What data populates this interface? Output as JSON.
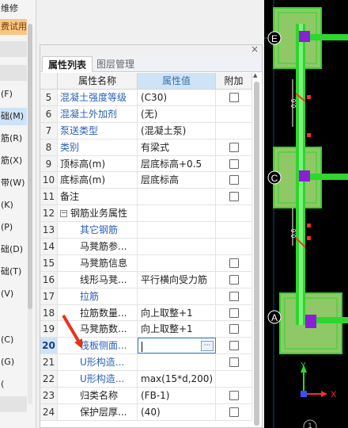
{
  "left_menu": {
    "items": [
      {
        "label": "维修"
      },
      {
        "label": "费试用"
      },
      {
        "label": "(F)"
      },
      {
        "label": "础(M)"
      },
      {
        "label": "筋(R)"
      },
      {
        "label": "筋(X)"
      },
      {
        "label": "带(W)"
      },
      {
        "label": "(K)"
      },
      {
        "label": "(P)"
      },
      {
        "label": "础(D)"
      },
      {
        "label": "础(T)"
      },
      {
        "label": "(V)"
      },
      {
        "label": ""
      },
      {
        "label": "(C)"
      },
      {
        "label": "(G)"
      },
      {
        "label": "("
      }
    ]
  },
  "panel": {
    "close_glyph": "×",
    "tabs": [
      "属性列表",
      "图层管理"
    ],
    "columns": {
      "name": "属性名称",
      "value": "属性值",
      "add": "附加"
    },
    "rows": [
      {
        "num": "5",
        "name": "混凝土强度等级",
        "value": "(C30)",
        "blue": true,
        "check": true
      },
      {
        "num": "6",
        "name": "混凝土外加剂",
        "value": "(无)",
        "blue": true,
        "check": false
      },
      {
        "num": "7",
        "name": "泵送类型",
        "value": "(混凝土泵)",
        "blue": true,
        "check": false
      },
      {
        "num": "8",
        "name": "类别",
        "value": "有梁式",
        "blue": true,
        "check": true
      },
      {
        "num": "9",
        "name": "顶标高(m)",
        "value": "层底标高+0.5",
        "blue": false,
        "check": true
      },
      {
        "num": "10",
        "name": "底标高(m)",
        "value": "层底标高",
        "blue": false,
        "check": true
      },
      {
        "num": "11",
        "name": "备注",
        "value": "",
        "blue": false,
        "check": true
      },
      {
        "num": "12",
        "name": "钢筋业务属性",
        "value": "",
        "blue": false,
        "check": false,
        "group": true,
        "toggle": "−"
      },
      {
        "num": "13",
        "name": "其它钢筋",
        "value": "",
        "blue": true,
        "check": false,
        "indent": true
      },
      {
        "num": "14",
        "name": "马凳筋参...",
        "value": "",
        "blue": false,
        "check": false,
        "indent": true
      },
      {
        "num": "15",
        "name": "马凳筋信息",
        "value": "",
        "blue": false,
        "check": true,
        "indent": true
      },
      {
        "num": "16",
        "name": "线形马凳...",
        "value": "平行横向受力筋",
        "blue": false,
        "check": true,
        "indent": true
      },
      {
        "num": "17",
        "name": "拉筋",
        "value": "",
        "blue": true,
        "check": true,
        "indent": true
      },
      {
        "num": "18",
        "name": "拉筋数量...",
        "value": "向上取整+1",
        "blue": false,
        "check": true,
        "indent": true
      },
      {
        "num": "19",
        "name": "马凳筋数...",
        "value": "向上取整+1",
        "blue": false,
        "check": true,
        "indent": true
      },
      {
        "num": "20",
        "name": "筏板侧面...",
        "value": "",
        "blue": true,
        "check": true,
        "indent": true,
        "selected": true,
        "button": "···"
      },
      {
        "num": "21",
        "name": "U形构造...",
        "value": "",
        "blue": true,
        "check": true,
        "indent": true
      },
      {
        "num": "22",
        "name": "U形构造...",
        "value": "max(15*d,200)",
        "blue": true,
        "check": false,
        "indent": true
      },
      {
        "num": "23",
        "name": "归类名称",
        "value": "(FB-1)",
        "blue": false,
        "check": true,
        "indent": true
      },
      {
        "num": "24",
        "name": "保护层厚...",
        "value": "(40)",
        "blue": false,
        "check": true,
        "indent": true
      }
    ]
  },
  "cad": {
    "axis_labels": [
      "E",
      "C",
      "A"
    ],
    "dim_text": [
      "0.6",
      "0.6"
    ],
    "axis_letters": {
      "x": "X",
      "y": "Y"
    },
    "bottom_marker": "1",
    "colors": {
      "background": "#000000",
      "footing": "#8fc866",
      "rebar": "#2ed62e",
      "column": "#8a1fd6",
      "marker": "#ff2b2b"
    }
  },
  "annotation": {
    "color": "#e8321c"
  }
}
